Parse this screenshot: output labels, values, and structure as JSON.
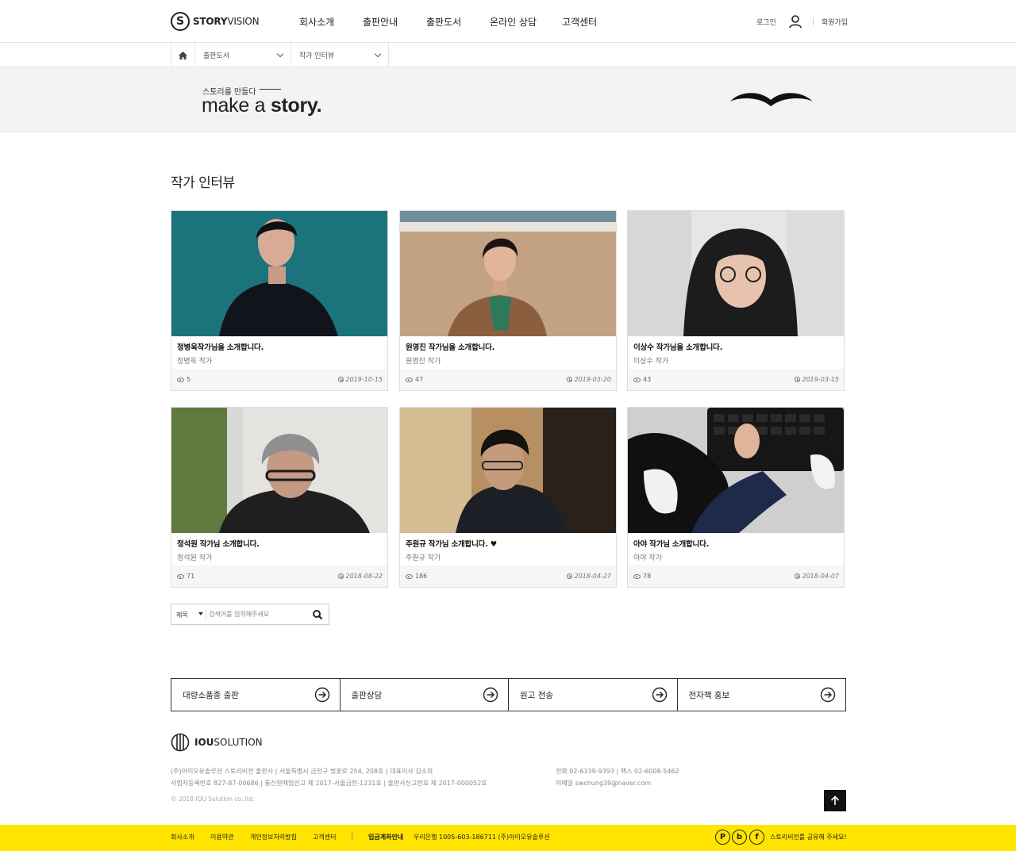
{
  "brand": {
    "logo_letter": "S",
    "name_bold": "STORY",
    "name_rest": "VISION"
  },
  "nav": [
    {
      "label": "회사소개"
    },
    {
      "label": "출판안내"
    },
    {
      "label": "출판도서"
    },
    {
      "label": "온라인 상담"
    },
    {
      "label": "고객센터"
    }
  ],
  "util": {
    "login": "로그인",
    "join": "회원가입"
  },
  "breadcrumb": {
    "cat1": "출판도서",
    "cat2": "작가 인터뷰"
  },
  "banner": {
    "sub": "스토리를 만들다",
    "main_light": "make a ",
    "main_bold": "story."
  },
  "page_title": "작가 인터뷰",
  "cards": [
    {
      "title": "정병욱작가님을 소개합니다.",
      "author": "정병욱 작가",
      "views": "5",
      "date": "2019-10-15"
    },
    {
      "title": "원영진 작가님을 소개합니다.",
      "author": "원영진 작가",
      "views": "47",
      "date": "2019-03-20"
    },
    {
      "title": "이상수 작가님을 소개합니다.",
      "author": "이상수 작가",
      "views": "43",
      "date": "2019-03-15"
    },
    {
      "title": "정석원 작가님 소개합니다.",
      "author": "정석원 작가",
      "views": "71",
      "date": "2018-08-22"
    },
    {
      "title": "주원규 작가님 소개합니다. ♥",
      "author": "주원규 작가",
      "views": "186",
      "date": "2018-04-27"
    },
    {
      "title": "아야 작가님 소개합니다.",
      "author": "아야 작가",
      "views": "78",
      "date": "2018-04-07"
    }
  ],
  "search": {
    "field": "제목",
    "placeholder": "검색어를 입력해주세요"
  },
  "quick_links": [
    {
      "label": "대량소품종 출판"
    },
    {
      "label": "출판상담"
    },
    {
      "label": "원고 전송"
    },
    {
      "label": "전자책 홍보"
    }
  ],
  "footer": {
    "logo_bold": "IOU",
    "logo_rest": "SOLUTION",
    "line1": "(주)아이오유솔루션 스토리비전 출판사  |  서울특별시 금천구 벚꽃로 254, 208호  |  대표이사 김소희",
    "line2": "사업자등록번호 827-87-00686  |  통신판매업신고 제 2017-서울금천-1231호  |  출판사신고번호 제 2017-000052호",
    "copyright": "© 2018 IOU Solution co.,ltd.",
    "tel": "전화 02-6339-9393  |  팩스 02-6008-5462",
    "email": "이메일 swchung39@naver.com"
  },
  "bottom_bar": {
    "links": [
      {
        "label": "회사소개"
      },
      {
        "label": "이용약관"
      },
      {
        "label": "개인정보처리방침"
      },
      {
        "label": "고객센터"
      }
    ],
    "bank_label": "입금계좌안내",
    "bank_info": "우리은행 1005-603-186711 (주)아이오유솔루션",
    "share_text": "스토리비전를 공유해 주세요!",
    "sns": [
      {
        "letter": "P"
      },
      {
        "letter": "b"
      },
      {
        "letter": "f"
      }
    ],
    "bar_color": "#ffe400"
  }
}
